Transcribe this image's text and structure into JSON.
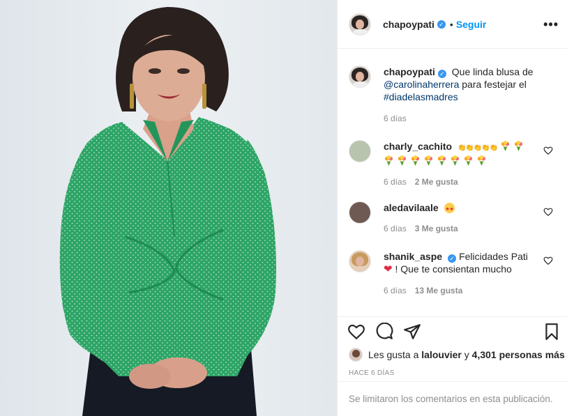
{
  "post": {
    "username": "chapoypati",
    "verified": true,
    "follow_label": "Seguir",
    "more_label": "•••",
    "caption": {
      "username": "chapoypati",
      "text_before": "Que linda blusa de",
      "mention": "@carolinaherrera",
      "text_middle": "para festejar el",
      "hashtag": "#diadelasmadres",
      "time": "6 días"
    },
    "comments": [
      {
        "username": "charly_cachito",
        "text": "",
        "time": "6 días",
        "likes": "2 Me gusta"
      },
      {
        "username": "aledavilaale",
        "text": "",
        "time": "6 días",
        "likes": "3 Me gusta"
      },
      {
        "username": "shanik_aspe",
        "text_before": "Felicidades Pati",
        "text_after": "! Que te consientan mucho",
        "time": "6 días",
        "likes": "13 Me gusta"
      }
    ],
    "likes_prefix": "Les gusta a",
    "likes_user": "lalouvier",
    "likes_joiner": "y",
    "likes_count": "4,301 personas más",
    "time_ago": "HACE 6 DÍAS",
    "comments_disabled": "Se limitaron los comentarios en esta publicación.",
    "colors": {
      "accent": "#0095f6",
      "verified": "#3897f0",
      "blouse": "#2fa868"
    }
  }
}
